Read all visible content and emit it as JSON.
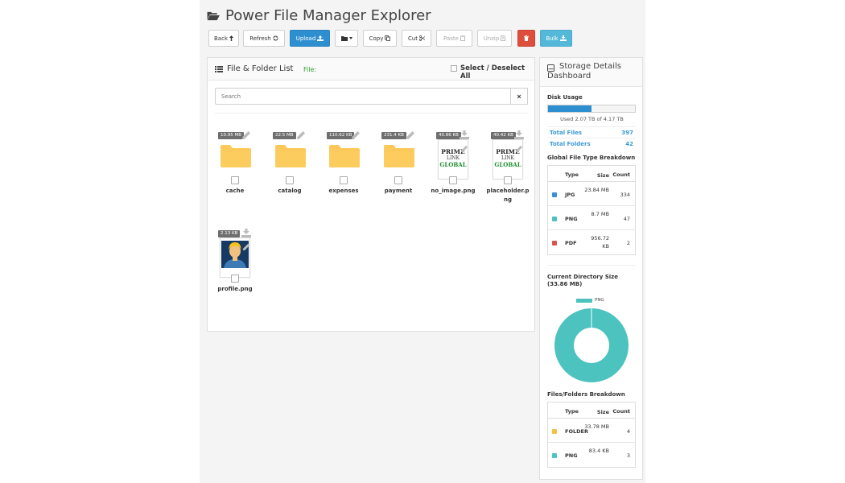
{
  "app": {
    "title": "Power File Manager Explorer"
  },
  "toolbar": {
    "back": "Back",
    "refresh": "Refresh",
    "upload": "Upload",
    "copy": "Copy",
    "cut": "Cut",
    "paste": "Paste",
    "unzip": "Unzip",
    "bulk": "Bulk"
  },
  "list_panel": {
    "title": "File & Folder List",
    "file_label": "File:",
    "select_all": "Select / Deselect All",
    "search_placeholder": "Search",
    "clear": "×"
  },
  "items": [
    {
      "name": "cache",
      "size": "10.95 MB",
      "kind": "folder"
    },
    {
      "name": "catalog",
      "size": "22.5 MB",
      "kind": "folder"
    },
    {
      "name": "expenses",
      "size": "110.62 KB",
      "kind": "folder"
    },
    {
      "name": "payment",
      "size": "231.4 KB",
      "kind": "folder"
    },
    {
      "name": "no_image.png",
      "size": "40.86 KB",
      "kind": "image"
    },
    {
      "name": "placeholder.png",
      "size": "40.42 KB",
      "kind": "image"
    },
    {
      "name": "profile.png",
      "size": "2.13 KB",
      "kind": "image"
    }
  ],
  "placeholder_logo": {
    "line1": "PRIME",
    "line2": "LINK",
    "line3": "GLOBAL"
  },
  "storage": {
    "title": "Storage Details Dashboard",
    "disk_usage_label": "Disk Usage",
    "used_fraction": 0.496,
    "used_text": "Used 2.07 TB of 4.17 TB",
    "total_files_label": "Total Files",
    "total_files": "397",
    "total_folders_label": "Total Folders",
    "total_folders": "42",
    "breakdown_title": "Global File Type Breakdown",
    "col_type": "Type",
    "col_size": "Size",
    "col_count": "Count",
    "breakdown": [
      {
        "type": "JPG",
        "size": "23.84 MB",
        "count": "334",
        "color": "#3a8fd6"
      },
      {
        "type": "PNG",
        "size": "8.7 MB",
        "count": "47",
        "color": "#4cc3bf"
      },
      {
        "type": "PDF",
        "size": "956.72 KB",
        "count": "2",
        "color": "#d9534f"
      }
    ],
    "current_dir_title": "Current Directory Size (33.86 MB)",
    "chart_legend": "PNG",
    "chart_color": "#4cc3bf",
    "files_folders_title": "Files/Folders Breakdown",
    "files_folders": [
      {
        "type": "FOLDER",
        "size": "33.78 MB",
        "count": "4",
        "color": "#f5c342"
      },
      {
        "type": "PNG",
        "size": "83.4 KB",
        "count": "3",
        "color": "#4cc3bf"
      }
    ]
  },
  "colors": {
    "primary": "#2d8fd0",
    "danger": "#de4e3c",
    "info": "#54b8d8",
    "folder": "#fdc95a"
  }
}
